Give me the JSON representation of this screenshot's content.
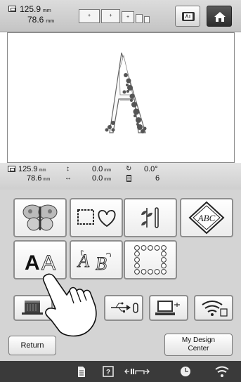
{
  "header": {
    "size_width": "125.9",
    "size_height": "78.6",
    "unit": "mm",
    "frame_labels": [
      "+",
      "+",
      "+"
    ],
    "camera_icon": "camera-icon",
    "home_icon": "home-icon"
  },
  "canvas": {
    "design_letter": "A"
  },
  "info": {
    "size_width": "125.9",
    "size_height": "78.6",
    "unit": "mm",
    "offset_vertical": "0.0",
    "offset_horizontal": "0.0",
    "rotation": "0.0°",
    "color_count": "6"
  },
  "categories": [
    {
      "name": "embroidery-patterns",
      "icon": "butterfly-icon"
    },
    {
      "name": "frame-patterns",
      "icon": "frame-heart-icon"
    },
    {
      "name": "utility-patterns",
      "icon": "plant-bar-icon"
    },
    {
      "name": "monogram-patterns",
      "icon": "monogram-icon",
      "text": "ABC"
    },
    {
      "name": "character-patterns",
      "icon": "letters-icon",
      "text": "AA"
    },
    {
      "name": "decorative-alphabet",
      "icon": "decorative-alphabet-icon",
      "text": "AB"
    },
    {
      "name": "border-patterns",
      "icon": "bead-frame-icon"
    }
  ],
  "io_buttons": [
    {
      "name": "machine-memory",
      "icon": "machine-icon"
    },
    {
      "name": "usb",
      "icon": "usb-icon"
    },
    {
      "name": "computer",
      "icon": "computer-icon"
    },
    {
      "name": "wireless",
      "icon": "wireless-icon"
    }
  ],
  "footer": {
    "return_label": "Return",
    "design_center_line1": "My Design",
    "design_center_line2": "Center"
  },
  "colors": {
    "topbar": "#cfcfcf",
    "panel": "#d4d4d4",
    "statusbar": "#3a3a3a",
    "border": "#8e8e8e"
  }
}
